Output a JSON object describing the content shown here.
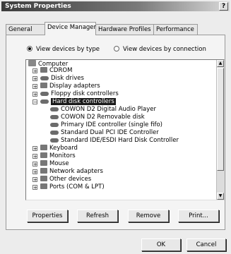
{
  "window": {
    "title": "System Properties",
    "help_label": "?"
  },
  "tabs": [
    {
      "label": "General",
      "active": false
    },
    {
      "label": "Device Manager",
      "active": true
    },
    {
      "label": "Hardware Profiles",
      "active": false
    },
    {
      "label": "Performance",
      "active": false
    }
  ],
  "view_options": {
    "by_type": "View devices by type",
    "by_connection": "View devices by connection",
    "selected": "by_type"
  },
  "tree": {
    "root": "Computer",
    "items": [
      "CDROM",
      "Disk drives",
      "Display adapters",
      "Floppy disk controllers",
      "Hard disk controllers",
      "COWON D2 Digital Audio Player",
      "COWON D2 Removable disk",
      "Primary IDE controller (single fifo)",
      "Standard Dual PCI IDE Controller",
      "Standard IDE/ESDI Hard Disk Controller",
      "Keyboard",
      "Monitors",
      "Mouse",
      "Network adapters",
      "Other devices",
      "Ports (COM & LPT)"
    ],
    "selected": "Hard disk controllers"
  },
  "buttons": {
    "properties": "Properties",
    "refresh": "Refresh",
    "remove": "Remove",
    "print": "Print...",
    "ok": "OK",
    "cancel": "Cancel"
  }
}
